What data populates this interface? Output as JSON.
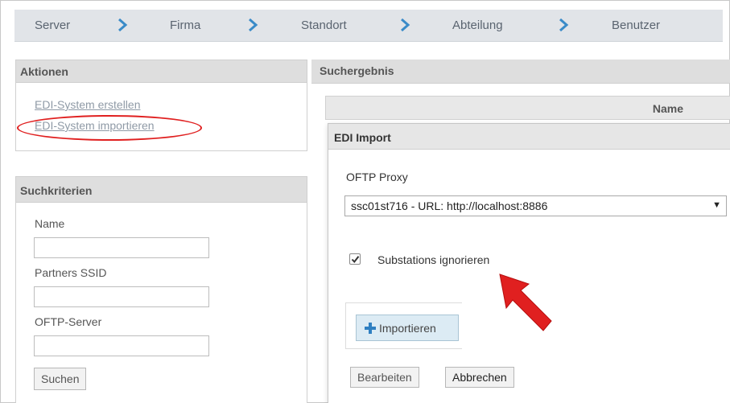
{
  "breadcrumb": {
    "items": [
      "Server",
      "Firma",
      "Standort",
      "Abteilung",
      "Benutzer"
    ]
  },
  "actions": {
    "title": "Aktionen",
    "create_link": "EDI-System erstellen",
    "import_link": "EDI-System importieren"
  },
  "search": {
    "title": "Suchkriterien",
    "name_label": "Name",
    "name_value": "",
    "ssid_label": "Partners SSID",
    "ssid_value": "",
    "oftp_label": "OFTP-Server",
    "oftp_value": "",
    "search_button": "Suchen"
  },
  "results": {
    "title": "Suchergebnis",
    "column_name": "Name"
  },
  "dialog": {
    "title": "EDI Import",
    "proxy_label": "OFTP Proxy",
    "proxy_selected": "ssc01st716 - URL: http://localhost:8886",
    "checkbox_label": "Substations ignorieren",
    "checkbox_checked": true,
    "import_button": "Importieren",
    "edit_button": "Bearbeiten",
    "cancel_button": "Abbrechen"
  },
  "colors": {
    "annotation_red": "#e02020",
    "import_button_bg": "#dcebf4",
    "plus_icon": "#2f7fc1"
  }
}
